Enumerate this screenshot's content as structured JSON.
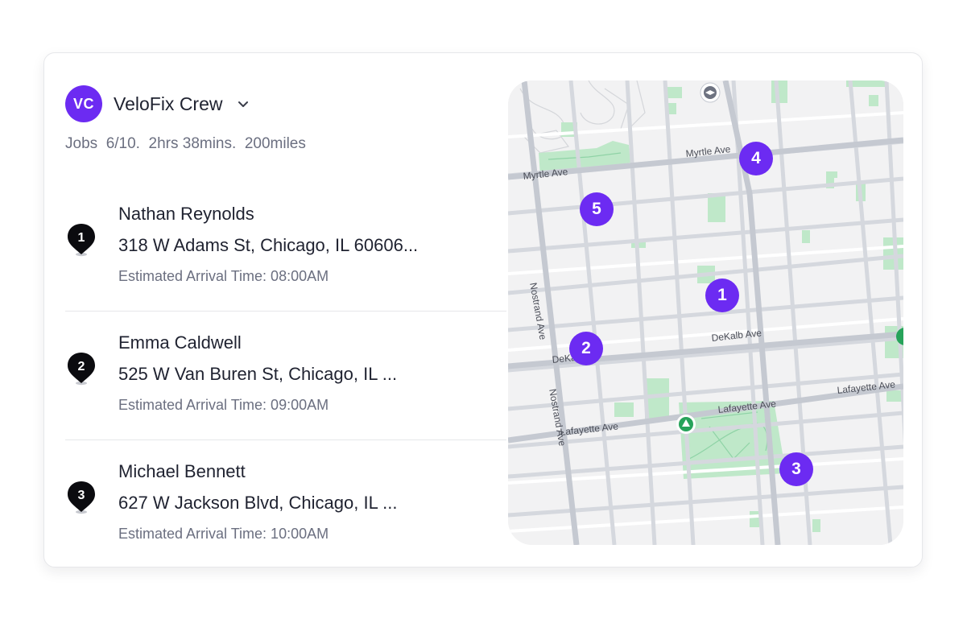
{
  "colors": {
    "accent": "#6c2bf2",
    "pin": "#0b0b0f",
    "park": "#bfe8c9",
    "park_pin": "#27a35a"
  },
  "crew": {
    "avatar_initials": "VC",
    "name": "VeloFix Crew",
    "dropdown_icon": "chevron-down-icon",
    "stats": "Jobs  6/10.  2hrs 38mins.  200miles"
  },
  "jobs": [
    {
      "number": "1",
      "name": "Nathan Reynolds",
      "address": "318 W Adams St, Chicago, IL 60606...",
      "eta": "Estimated Arrival Time: 08:00AM"
    },
    {
      "number": "2",
      "name": "Emma Caldwell",
      "address": "525 W Van Buren St, Chicago, IL ...",
      "eta": "Estimated Arrival Time: 09:00AM"
    },
    {
      "number": "3",
      "name": "Michael Bennett",
      "address": "627 W Jackson Blvd, Chicago, IL ...",
      "eta": "Estimated Arrival Time: 10:00AM"
    }
  ],
  "map": {
    "markers": [
      {
        "label": "1"
      },
      {
        "label": "2"
      },
      {
        "label": "3"
      },
      {
        "label": "4"
      },
      {
        "label": "5"
      }
    ],
    "streets": {
      "myrtle_left": "Myrtle Ave",
      "myrtle_right": "Myrtle Ave",
      "dekalb_right": "DeKalb Ave",
      "dekalb_left": "DeKal",
      "lafayette_left": "Lafayette Ave",
      "lafayette_mid": "Lafayette Ave",
      "lafayette_right": "Lafayette Ave",
      "nostrand_upper": "Nostrand Ave",
      "nostrand_lower": "Nostrand Ave"
    },
    "icons": [
      "school-icon",
      "park-tree-icon",
      "park-pin-icon"
    ]
  }
}
